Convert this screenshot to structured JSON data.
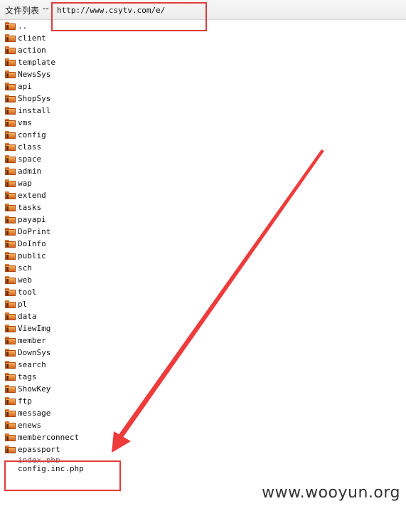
{
  "header": {
    "title": "文件列表",
    "separator": "--",
    "url": "http://www.csytv.com/e/"
  },
  "files": [
    {
      "name": "..",
      "type": "folder"
    },
    {
      "name": "client",
      "type": "folder"
    },
    {
      "name": "action",
      "type": "folder"
    },
    {
      "name": "template",
      "type": "folder"
    },
    {
      "name": "NewsSys",
      "type": "folder"
    },
    {
      "name": "api",
      "type": "folder"
    },
    {
      "name": "ShopSys",
      "type": "folder"
    },
    {
      "name": "install",
      "type": "folder"
    },
    {
      "name": "vms",
      "type": "folder"
    },
    {
      "name": "config",
      "type": "folder"
    },
    {
      "name": "class",
      "type": "folder"
    },
    {
      "name": "space",
      "type": "folder"
    },
    {
      "name": "admin",
      "type": "folder"
    },
    {
      "name": "wap",
      "type": "folder"
    },
    {
      "name": "extend",
      "type": "folder"
    },
    {
      "name": "tasks",
      "type": "folder"
    },
    {
      "name": "payapi",
      "type": "folder"
    },
    {
      "name": "DoPrint",
      "type": "folder"
    },
    {
      "name": "DoInfo",
      "type": "folder"
    },
    {
      "name": "public",
      "type": "folder"
    },
    {
      "name": "sch",
      "type": "folder"
    },
    {
      "name": "web",
      "type": "folder"
    },
    {
      "name": "tool",
      "type": "folder"
    },
    {
      "name": "pl",
      "type": "folder"
    },
    {
      "name": "data",
      "type": "folder"
    },
    {
      "name": "ViewImg",
      "type": "folder"
    },
    {
      "name": "member",
      "type": "folder"
    },
    {
      "name": "DownSys",
      "type": "folder"
    },
    {
      "name": "search",
      "type": "folder"
    },
    {
      "name": "tags",
      "type": "folder"
    },
    {
      "name": "ShowKey",
      "type": "folder"
    },
    {
      "name": "ftp",
      "type": "folder"
    },
    {
      "name": "message",
      "type": "folder"
    },
    {
      "name": "enews",
      "type": "folder"
    },
    {
      "name": "memberconnect",
      "type": "folder"
    },
    {
      "name": "epassport",
      "type": "folder"
    },
    {
      "name": "index.php",
      "type": "file",
      "partially_hidden": true
    },
    {
      "name": "config.inc.php",
      "type": "file"
    }
  ],
  "watermark": "www.wooyun.org",
  "colors": {
    "highlight": "#e03b3b",
    "folder": "#e0762a"
  },
  "icons": {
    "folder": "folder-icon",
    "file": "file-icon",
    "arrow": "red-arrow"
  }
}
